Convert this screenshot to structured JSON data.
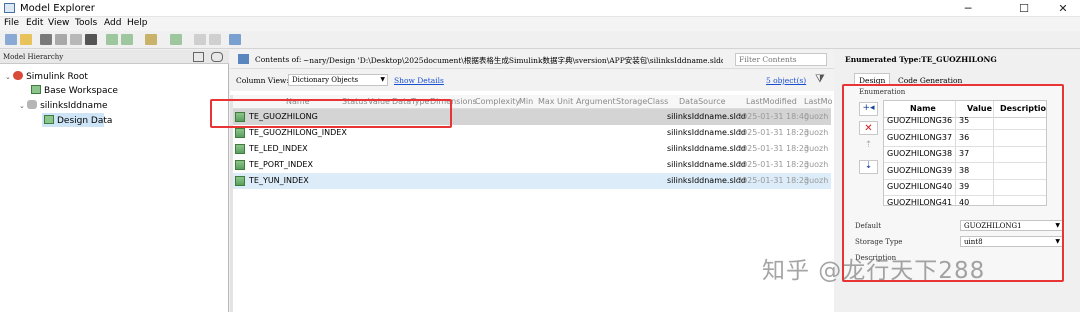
{
  "window": {
    "title": "Model Explorer",
    "minimize": "─",
    "maximize": "☐",
    "close": "✕"
  },
  "menu": [
    "File",
    "Edit",
    "View",
    "Tools",
    "Add",
    "Help"
  ],
  "hierarchy": {
    "title": "Model Hierarchy",
    "items": [
      "Simulink Root",
      "Base Workspace",
      "silinksIddname",
      "Design Data"
    ]
  },
  "contents": {
    "label": "Contents of:",
    "path": "~nary/Design 'D:\\Desktop\\2025document\\根据表格生成Simulink数据字典\\sversion\\APP安装包\\silinksIddname.sldd' (only)",
    "filter_placeholder": "Filter Contents",
    "column_view_label": "Column View:",
    "column_view_value": "Dictionary Objects",
    "show_details": "Show Details",
    "object_count": "5 object(s)"
  },
  "columns": [
    "Name",
    "Status",
    "Value",
    "DataType",
    "Dimensions",
    "Complexity",
    "Min",
    "Max",
    "Unit",
    "Argument",
    "StorageClass",
    "DataSource",
    "LastModified",
    "LastMo"
  ],
  "rows": [
    {
      "name": "TE_GUOZHILONG",
      "source": "silinksIddname.sldd",
      "modified": "2025-01-31 18:40",
      "by": "guozh"
    },
    {
      "name": "TE_GUOZHILONG_INDEX",
      "source": "silinksIddname.sldd",
      "modified": "2025-01-31 18:23",
      "by": "guozh"
    },
    {
      "name": "TE_LED_INDEX",
      "source": "silinksIddname.sldd",
      "modified": "2025-01-31 18:23",
      "by": "guozh"
    },
    {
      "name": "TE_PORT_INDEX",
      "source": "silinksIddname.sldd",
      "modified": "2025-01-31 18:23",
      "by": "guozh"
    },
    {
      "name": "TE_YUN_INDEX",
      "source": "silinksIddname.sldd",
      "modified": "2025-01-31 18:23",
      "by": "guozh"
    }
  ],
  "props": {
    "title": "Enumerated Type:TE_GUOZHILONG",
    "tabs": [
      "Design",
      "Code Generation"
    ],
    "enum_group": "Enumeration",
    "enum_headers": [
      "Name",
      "Value",
      "Description"
    ],
    "enum_rows": [
      {
        "name": "GUOZHILONG36",
        "value": "35"
      },
      {
        "name": "GUOZHILONG37",
        "value": "36"
      },
      {
        "name": "GUOZHILONG38",
        "value": "37"
      },
      {
        "name": "GUOZHILONG39",
        "value": "38"
      },
      {
        "name": "GUOZHILONG40",
        "value": "39"
      },
      {
        "name": "GUOZHILONG41",
        "value": "40"
      }
    ],
    "default_label": "Default",
    "default_value": "GUOZHILONG1",
    "storage_label": "Storage Type",
    "storage_value": "uint8",
    "desc_label": "Description"
  },
  "watermark": "知乎 @龙行天下288",
  "colors": {
    "highlight_red": "#e83434",
    "selected_row": "#d4d4d4",
    "hover_row": "#dcecf8"
  }
}
